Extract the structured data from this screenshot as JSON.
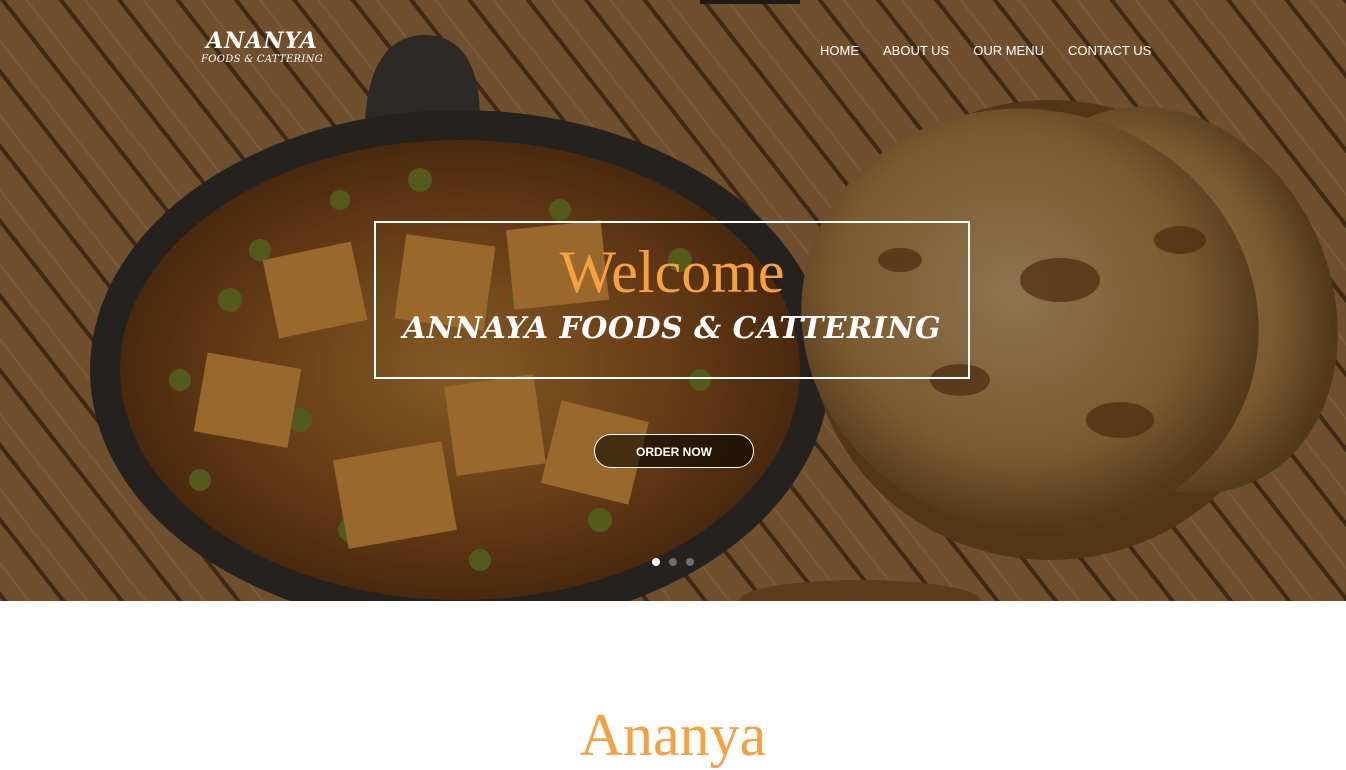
{
  "brand": {
    "title": "ANANYA",
    "subtitle": "FOODS & CATTERING"
  },
  "nav": {
    "items": [
      {
        "label": "HOME"
      },
      {
        "label": "ABOUT US"
      },
      {
        "label": "OUR MENU"
      },
      {
        "label": "CONTACT US"
      }
    ]
  },
  "hero": {
    "welcome": "Welcome",
    "tagline": "ANNAYA FOODS & CATTERING",
    "cta_label": "ORDER NOW",
    "slides": {
      "count": 3,
      "active": 1
    }
  },
  "section": {
    "title": "Ananya"
  },
  "colors": {
    "accent": "#f5a041",
    "text_light": "#ffffff"
  }
}
